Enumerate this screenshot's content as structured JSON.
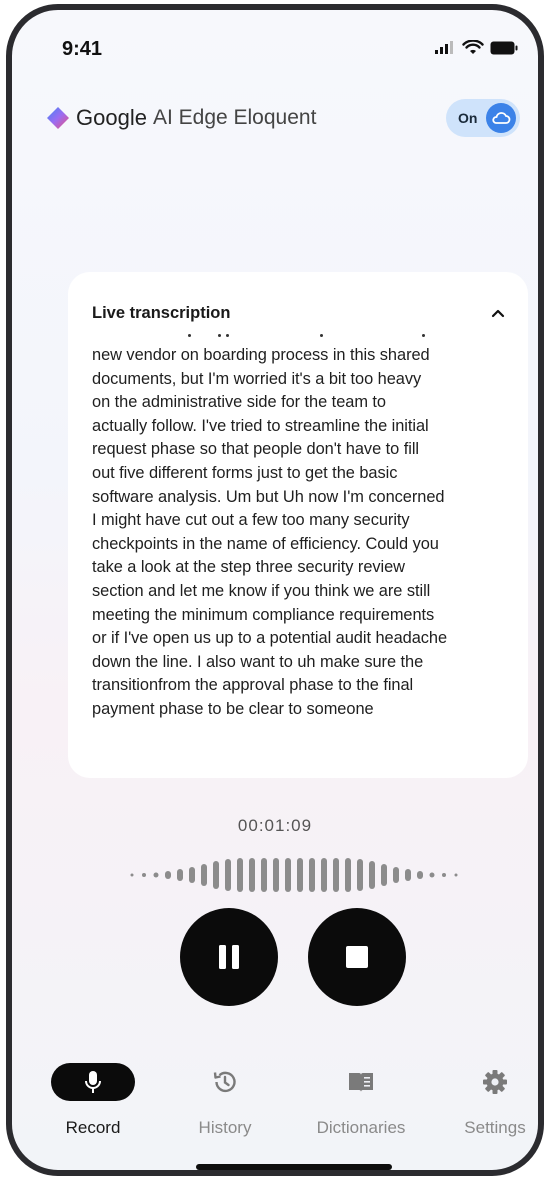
{
  "status": {
    "time": "9:41"
  },
  "header": {
    "brand_google": "Google",
    "brand_product": "AI Edge Eloquent",
    "toggle_label": "On"
  },
  "card": {
    "title": "Live transcription",
    "transcript": "new vendor on boarding process in this shared\ndocuments, but I'm worried it's a bit too heavy\non the administrative side for the team to\nactually follow. I've tried to streamline the initial\nrequest phase so that people don't have to fill\nout five different forms just to get the basic\nsoftware analysis. Um but Uh now I'm concerned\nI might have cut out a few too many security\ncheckpoints in the name of efficiency. Could you\ntake a look at the step three security review\nsection and let me know if you think we are still\nmeeting the minimum compliance requirements\nor if I've open us up to a potential audit headache\ndown the line. I also want to  uh make sure the\ntransitionfrom the approval phase to the final\npayment phase to be clear to someone"
  },
  "recorder": {
    "timer": "00:01:09"
  },
  "nav": {
    "items": [
      {
        "label": "Record",
        "icon": "mic-icon",
        "active": true
      },
      {
        "label": "History",
        "icon": "history-icon",
        "active": false
      },
      {
        "label": "Dictionaries",
        "icon": "book-icon",
        "active": false
      },
      {
        "label": "Settings",
        "icon": "gear-icon",
        "active": false
      }
    ]
  },
  "colors": {
    "accent": "#3b82e8",
    "toggle_bg": "#cfe3fb",
    "button": "#0b0b0b"
  }
}
